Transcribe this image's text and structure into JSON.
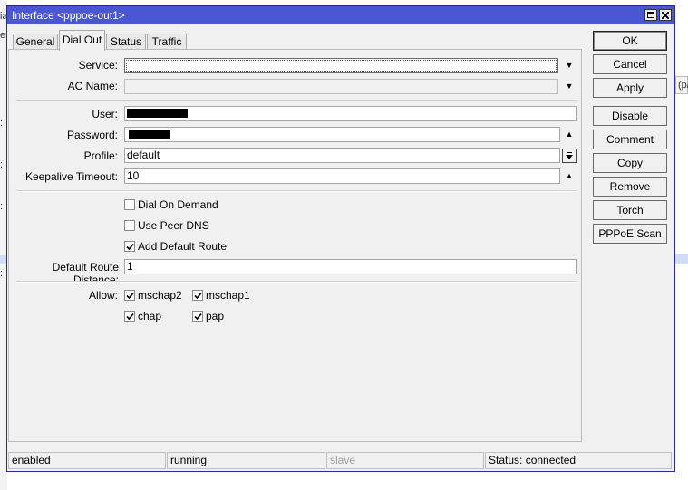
{
  "window": {
    "title": "Interface <pppoe-out1>"
  },
  "background": {
    "left_text": [
      "ia",
      "er",
      ":",
      ":",
      ":",
      ":"
    ],
    "right_text": "(p/"
  },
  "tabs": [
    {
      "label": "General"
    },
    {
      "label": "Dial Out"
    },
    {
      "label": "Status"
    },
    {
      "label": "Traffic"
    }
  ],
  "form": {
    "service": {
      "label": "Service:",
      "value": ""
    },
    "ac_name": {
      "label": "AC Name:",
      "value": ""
    },
    "user": {
      "label": "User:",
      "value": ""
    },
    "password": {
      "label": "Password:",
      "value": ""
    },
    "profile": {
      "label": "Profile:",
      "value": "default"
    },
    "keepalive": {
      "label": "Keepalive Timeout:",
      "value": "10"
    },
    "dial_on_demand": {
      "label": "Dial On Demand",
      "checked": false
    },
    "use_peer_dns": {
      "label": "Use Peer DNS",
      "checked": false
    },
    "add_default_route": {
      "label": "Add Default Route",
      "checked": true
    },
    "default_route_distance": {
      "label": "Default Route Distance:",
      "value": "1"
    },
    "allow": {
      "label": "Allow:",
      "options": [
        {
          "label": "mschap2",
          "checked": true
        },
        {
          "label": "mschap1",
          "checked": true
        },
        {
          "label": "chap",
          "checked": true
        },
        {
          "label": "pap",
          "checked": true
        }
      ]
    }
  },
  "buttons": {
    "ok": "OK",
    "cancel": "Cancel",
    "apply": "Apply",
    "disable": "Disable",
    "comment": "Comment",
    "copy": "Copy",
    "remove": "Remove",
    "torch": "Torch",
    "pppoe_scan": "PPPoE Scan"
  },
  "statusbar": [
    "enabled",
    "running",
    "slave",
    "Status: connected"
  ],
  "colors": {
    "titlebar": "#4a56d3",
    "selection_row": "#cfdcf2"
  }
}
